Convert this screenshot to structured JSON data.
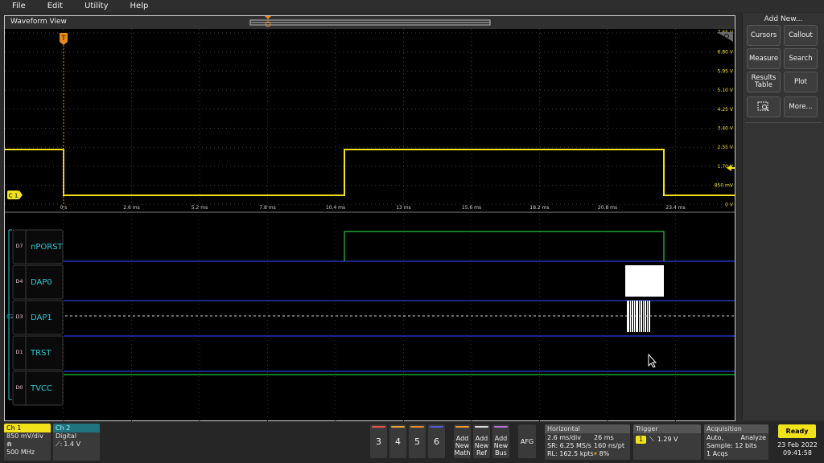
{
  "menu": [
    "File",
    "Edit",
    "Utility",
    "Help"
  ],
  "waveform_view": {
    "title": "Waveform View",
    "trigger_marker": "T",
    "analog_channel_label": "C 1",
    "y_tick_labels": [
      "7.65 V",
      "6.80 V",
      "5.95 V",
      "5.10 V",
      "4.25 V",
      "3.40 V",
      "2.55 V",
      "1.70 V",
      "850 mV",
      "0 V"
    ],
    "x_tick_labels": [
      "0 s",
      "2.6 ms",
      "5.2 ms",
      "7.8 ms",
      "10.4 ms",
      "13 ms",
      "15.6 ms",
      "18.2 ms",
      "20.8 ms",
      "23.4 ms"
    ],
    "digital_group_label": "C2",
    "digital_lanes": [
      {
        "bit": "D7",
        "name": "nPORST"
      },
      {
        "bit": "D4",
        "name": "DAP0"
      },
      {
        "bit": "D3",
        "name": "DAP1"
      },
      {
        "bit": "D1",
        "name": "TRST"
      },
      {
        "bit": "D0",
        "name": "TVCC"
      }
    ]
  },
  "add_new": {
    "title": "Add New...",
    "buttons": [
      "Cursors",
      "Callout",
      "Measure",
      "Search",
      "Results Table",
      "Plot",
      "More..."
    ]
  },
  "bottom": {
    "ch1": {
      "label": "Ch 1",
      "scale": "850 mV/div",
      "bandwidth": "500 MHz"
    },
    "ch2": {
      "label": "Ch 2",
      "type": "Digital",
      "threshold": "1.4 V"
    },
    "channel_buttons": [
      {
        "label": "3",
        "color": "#e8554e"
      },
      {
        "label": "4",
        "color": "#e8a33a"
      },
      {
        "label": "5",
        "color": "#e8892f"
      },
      {
        "label": "6",
        "color": "#4a5fd6"
      }
    ],
    "add_buttons": [
      {
        "label": "Add New Math",
        "color": "#e89a3a"
      },
      {
        "label": "Add New Ref",
        "color": "#dddddd"
      },
      {
        "label": "Add New Bus",
        "color": "#b76fd6"
      }
    ],
    "afg_label": "AFG",
    "horizontal": {
      "title": "Horizontal",
      "scale": "2.6 ms/div",
      "duration": "26 ms",
      "sample_rate": "SR: 6.25 MS/s",
      "resolution": "160 ns/pt",
      "record_length": "RL: 162.5 kpts",
      "position": "8%"
    },
    "trigger": {
      "title": "Trigger",
      "source": "1",
      "level": "1.29 V"
    },
    "acquisition": {
      "title": "Acquisition",
      "mode": "Auto,",
      "analyze": "Analyze",
      "sample": "Sample: 12 bits",
      "acqs": "1 Acqs"
    },
    "status": "Ready",
    "date": "23 Feb 2022",
    "time": "09:41:58"
  },
  "colors": {
    "analog_trace": "#f2e21a",
    "digital_high": "#22c53a",
    "digital_low": "#2b3fd6",
    "label_cyan": "#28c8d6",
    "trigger_orange": "#e88a1a",
    "ready_yellow": "#f2e21a"
  }
}
